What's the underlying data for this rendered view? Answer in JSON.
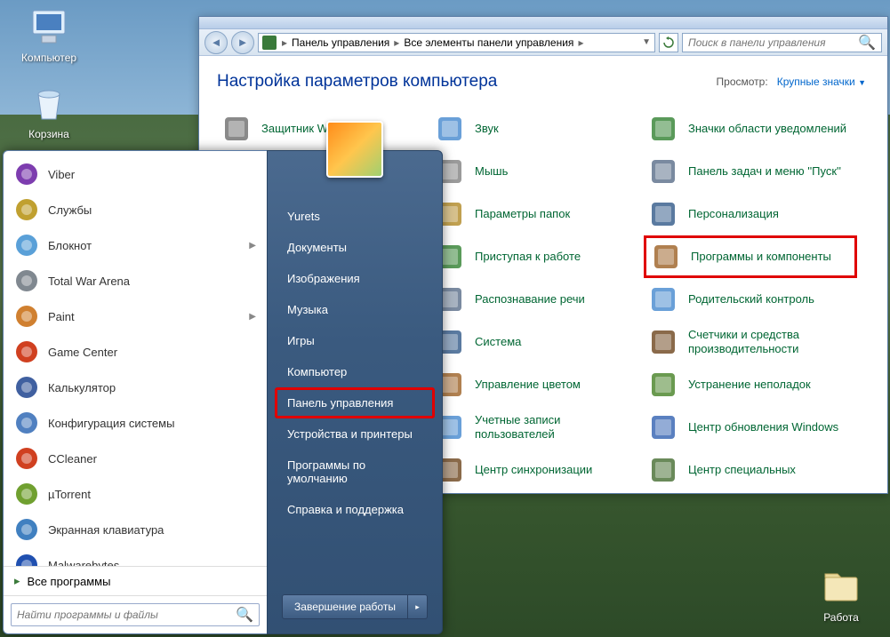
{
  "desktop": {
    "icons": [
      {
        "name": "computer-icon",
        "label": "Компьютер"
      },
      {
        "name": "recycle-bin-icon",
        "label": "Корзина"
      }
    ],
    "icons_right": [
      {
        "name": "work-folder-icon",
        "label": "Работа"
      }
    ]
  },
  "explorer": {
    "breadcrumb": [
      "Панель управления",
      "Все элементы панели управления"
    ],
    "search_placeholder": "Поиск в панели управления",
    "heading": "Настройка параметров компьютера",
    "view_label": "Просмотр:",
    "view_value": "Крупные значки",
    "items_col1": [
      {
        "icon": "shield-icon",
        "label": "Защитник Windows"
      }
    ],
    "items_col2": [
      {
        "icon": "speaker-icon",
        "label": "Звук"
      },
      {
        "icon": "mouse-icon",
        "label": "Мышь"
      },
      {
        "icon": "folder-options-icon",
        "label": "Параметры папок"
      },
      {
        "icon": "getting-started-icon",
        "label": "Приступая к работе"
      },
      {
        "icon": "speech-icon",
        "label": "Распознавание речи"
      },
      {
        "icon": "system-icon",
        "label": "Система"
      },
      {
        "icon": "color-mgmt-icon",
        "label": "Управление цветом"
      },
      {
        "icon": "user-accounts-icon",
        "label": "Учетные записи пользователей"
      },
      {
        "icon": "sync-icon",
        "label": "Центр синхронизации"
      }
    ],
    "items_col3": [
      {
        "icon": "notification-icon",
        "label": "Значки области уведомлений"
      },
      {
        "icon": "taskbar-icon",
        "label": "Панель задач и меню ''Пуск''"
      },
      {
        "icon": "personalize-icon",
        "label": "Персонализация"
      },
      {
        "icon": "programs-icon",
        "label": "Программы и компоненты",
        "highlight": true
      },
      {
        "icon": "parental-icon",
        "label": "Родительский контроль"
      },
      {
        "icon": "perfmon-icon",
        "label": "Счетчики и средства производительности"
      },
      {
        "icon": "troubleshoot-icon",
        "label": "Устранение неполадок"
      },
      {
        "icon": "update-icon",
        "label": "Центр обновления Windows"
      },
      {
        "icon": "accessibility-icon",
        "label": "Центр специальных"
      }
    ]
  },
  "start_menu": {
    "programs": [
      {
        "icon": "viber-icon",
        "label": "Viber",
        "color": "#7d3daf"
      },
      {
        "icon": "services-icon",
        "label": "Службы",
        "color": "#c0a030"
      },
      {
        "icon": "notepad-icon",
        "label": "Блокнот",
        "color": "#5aa0d8",
        "submenu": true
      },
      {
        "icon": "twa-icon",
        "label": "Total War Arena",
        "color": "#808890"
      },
      {
        "icon": "paint-icon",
        "label": "Paint",
        "color": "#d08030",
        "submenu": true
      },
      {
        "icon": "gamecenter-icon",
        "label": "Game Center",
        "color": "#d04020"
      },
      {
        "icon": "calc-icon",
        "label": "Калькулятор",
        "color": "#4060a0"
      },
      {
        "icon": "msconfig-icon",
        "label": "Конфигурация системы",
        "color": "#5080c0"
      },
      {
        "icon": "ccleaner-icon",
        "label": "CCleaner",
        "color": "#d04020"
      },
      {
        "icon": "utorrent-icon",
        "label": "µTorrent",
        "color": "#70a030"
      },
      {
        "icon": "osk-icon",
        "label": "Экранная клавиатура",
        "color": "#4080c0"
      },
      {
        "icon": "malwarebytes-icon",
        "label": "Malwarebytes",
        "color": "#2050b0"
      }
    ],
    "all_programs": "Все программы",
    "search_placeholder": "Найти программы и файлы",
    "right_items": [
      {
        "label": "Yurets"
      },
      {
        "label": "Документы"
      },
      {
        "label": "Изображения"
      },
      {
        "label": "Музыка"
      },
      {
        "label": "Игры"
      },
      {
        "label": "Компьютер"
      },
      {
        "label": "Панель управления",
        "highlight": true
      },
      {
        "label": "Устройства и принтеры"
      },
      {
        "label": "Программы по умолчанию"
      },
      {
        "label": "Справка и поддержка"
      }
    ],
    "shutdown_label": "Завершение работы"
  }
}
